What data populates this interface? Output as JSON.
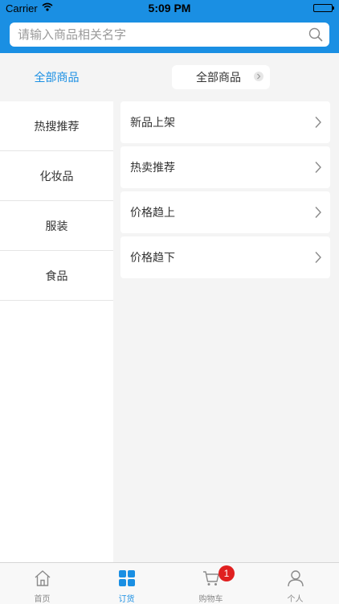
{
  "status_bar": {
    "carrier": "Carrier",
    "time": "5:09 PM",
    "battery_level": 1.0
  },
  "search": {
    "placeholder": "请输入商品相关名字",
    "value": ""
  },
  "category_header": {
    "label": "全部商品"
  },
  "filter": {
    "label": "全部商品"
  },
  "sidebar": {
    "items": [
      {
        "label": "热搜推荐"
      },
      {
        "label": "化妆品"
      },
      {
        "label": "服装"
      },
      {
        "label": "食品"
      }
    ]
  },
  "subcategories": {
    "items": [
      {
        "label": "新品上架"
      },
      {
        "label": "热卖推荐"
      },
      {
        "label": "价格趋上"
      },
      {
        "label": "价格趋下"
      }
    ]
  },
  "tabbar": {
    "tabs": [
      {
        "label": "首页",
        "icon": "home-icon",
        "active": false
      },
      {
        "label": "订货",
        "icon": "grid-icon",
        "active": true
      },
      {
        "label": "购物车",
        "icon": "cart-icon",
        "active": false
      },
      {
        "label": "个人",
        "icon": "person-icon",
        "active": false
      }
    ],
    "cart_badge": "1"
  },
  "colors": {
    "accent": "#1a8fe3",
    "badge": "#e02020",
    "background": "#f4f4f4"
  }
}
